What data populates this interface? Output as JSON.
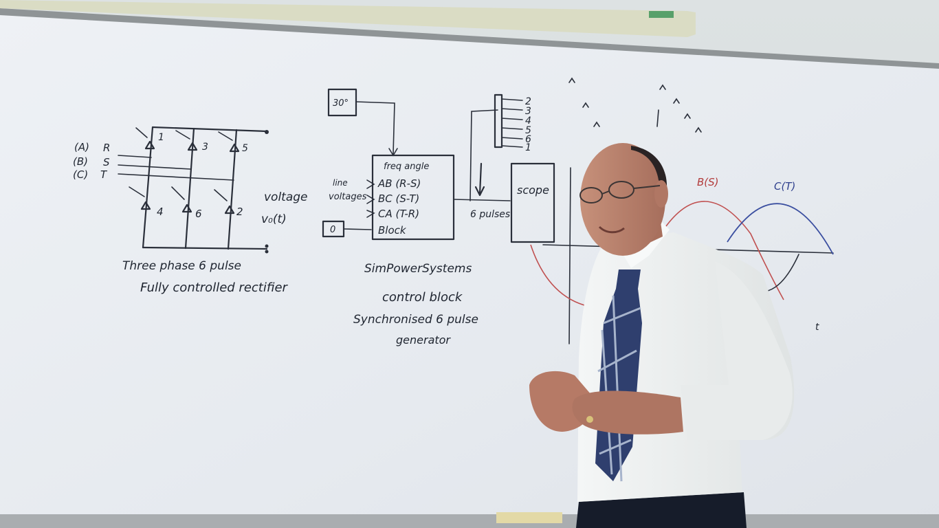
{
  "rectifier": {
    "phase_labels": [
      "(A)",
      "(B)",
      "(C)"
    ],
    "line_labels": [
      "R",
      "S",
      "T"
    ],
    "thyristor_top": [
      "1",
      "3",
      "5"
    ],
    "thyristor_bottom": [
      "4",
      "6",
      "2"
    ],
    "voltage_label": "voltage",
    "voltage_symbol": "v₀(t)",
    "caption_line1": "Three phase 6 pulse",
    "caption_line2": "Fully controlled rectifier"
  },
  "control_block": {
    "angle_box": "30°",
    "zero_box": "0",
    "line_voltages_label": [
      "line",
      "voltages"
    ],
    "rows": [
      "freq angle",
      "AB (R-S)",
      "BC (S-T)",
      "CA (T-R)",
      "Block"
    ],
    "output_label": "6 pulses",
    "caption": [
      "SimPowerSystems",
      "control block",
      "Synchronised 6 pulse",
      "generator"
    ]
  },
  "scope": {
    "label": "scope",
    "channel_numbers": [
      "2",
      "3",
      "4",
      "5",
      "6",
      "1"
    ]
  },
  "waveforms": {
    "label_b": "B(S)",
    "label_c": "C(T)",
    "axis_t": "t"
  }
}
